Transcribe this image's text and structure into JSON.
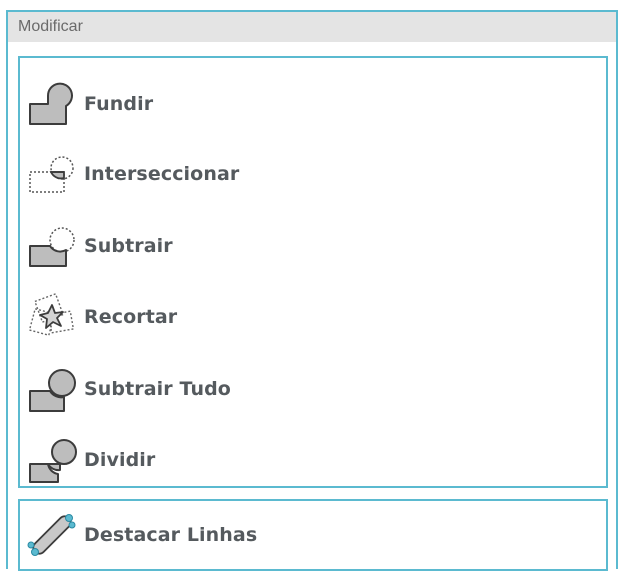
{
  "panel": {
    "title": "Modificar"
  },
  "items": [
    {
      "label": "Fundir",
      "icon": "weld-icon"
    },
    {
      "label": "Interseccionar",
      "icon": "intersect-icon"
    },
    {
      "label": "Subtrair",
      "icon": "subtract-icon"
    },
    {
      "label": "Recortar",
      "icon": "crop-icon"
    },
    {
      "label": "Subtrair Tudo",
      "icon": "subtract-all-icon"
    },
    {
      "label": "Dividir",
      "icon": "divide-icon"
    }
  ],
  "lines": {
    "label": "Destacar Linhas",
    "icon": "detach-lines-icon"
  },
  "colors": {
    "accent": "#5bbad0",
    "header_bg": "#e4e4e4",
    "label": "#555a5e",
    "shape_fill": "#bdbdbd",
    "shape_stroke": "#3c3c3c"
  }
}
